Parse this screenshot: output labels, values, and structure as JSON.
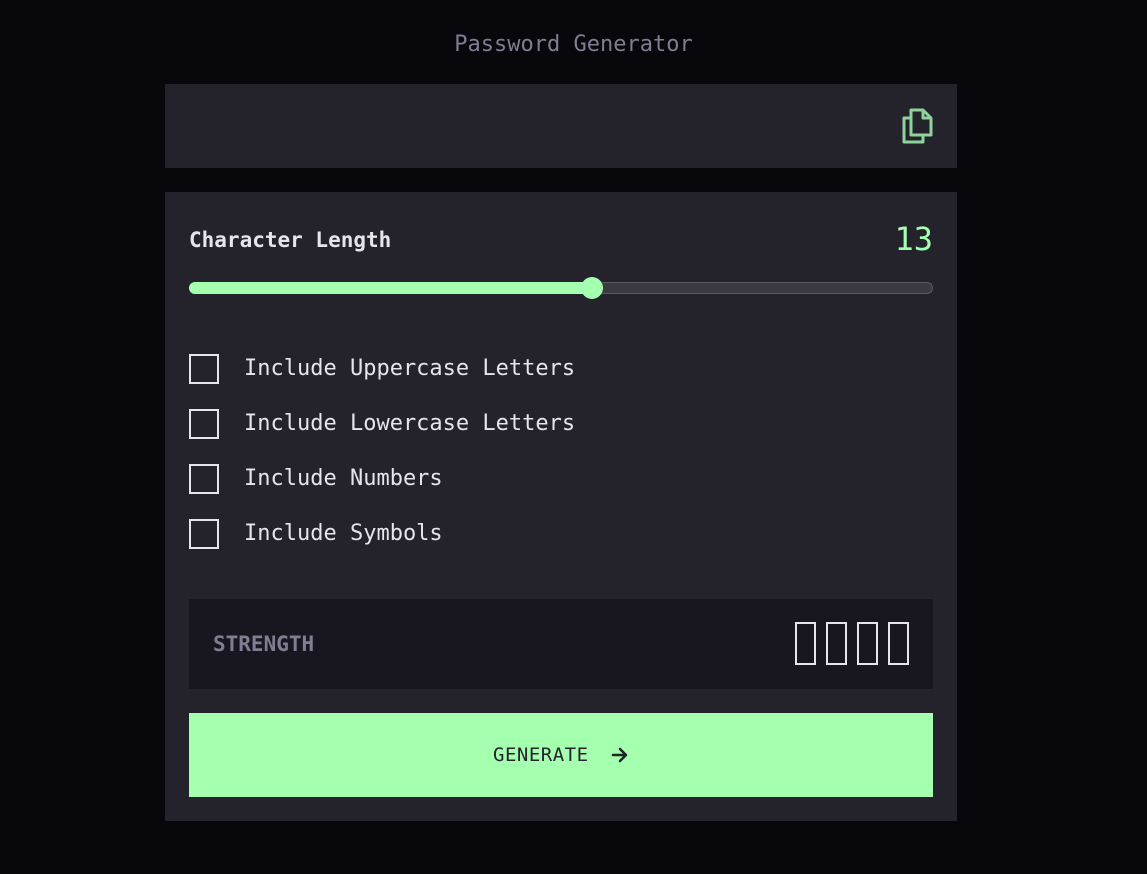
{
  "app": {
    "title": "Password Generator"
  },
  "password": {
    "value": "",
    "copy_icon": "copy-icon"
  },
  "settings": {
    "length_label": "Character Length",
    "length_value": "13",
    "slider": {
      "min": 0,
      "max": 24,
      "value": 13
    },
    "options": [
      {
        "label": "Include Uppercase Letters",
        "checked": false
      },
      {
        "label": "Include Lowercase Letters",
        "checked": false
      },
      {
        "label": "Include Numbers",
        "checked": false
      },
      {
        "label": "Include Symbols",
        "checked": false
      }
    ]
  },
  "strength": {
    "label": "STRENGTH",
    "level_text": "",
    "bars_filled": 0,
    "bars_total": 4
  },
  "generate": {
    "label": "GENERATE",
    "icon": "arrow-right-icon"
  },
  "colors": {
    "background": "#08070b",
    "panel": "#24232c",
    "accent": "#a4ffaf",
    "text": "#e6e5ea",
    "muted": "#817d92",
    "strength_bg": "#18171f"
  }
}
